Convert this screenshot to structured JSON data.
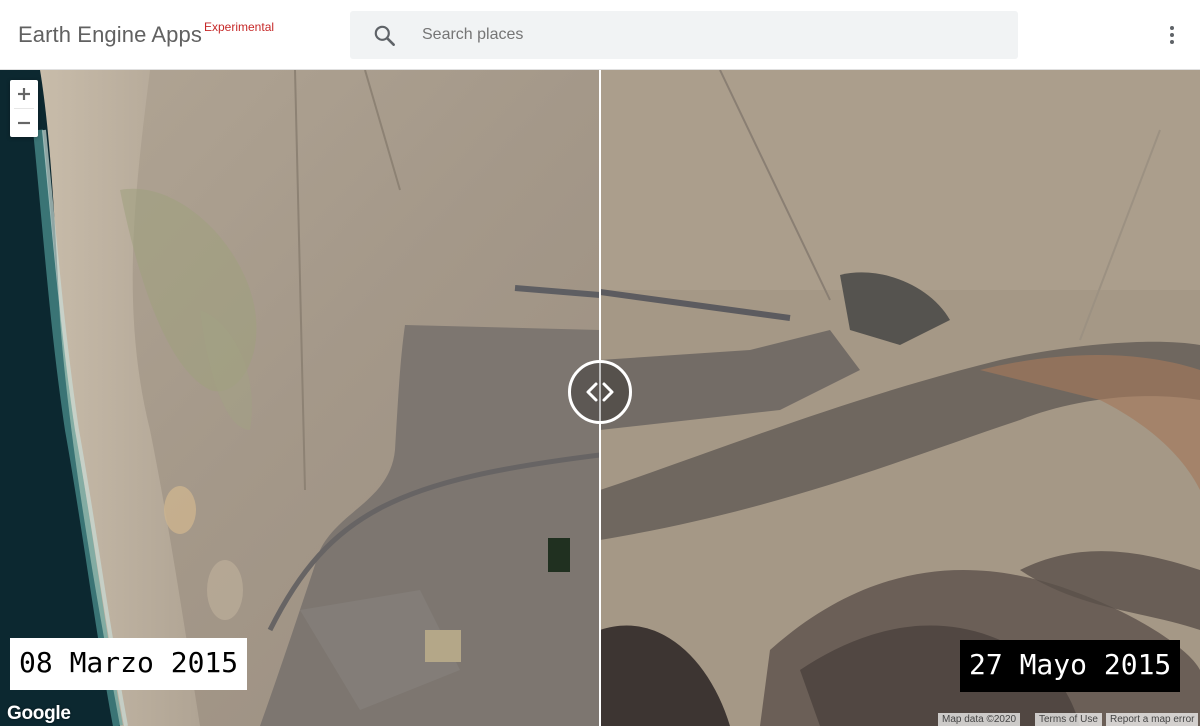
{
  "header": {
    "app_title": "Earth Engine Apps",
    "title_tag": "Experimental",
    "search": {
      "placeholder": "Search places",
      "value": "",
      "icon": "search-icon"
    },
    "menu_icon": "more-vert-icon"
  },
  "map": {
    "left_date": "08 Marzo 2015",
    "right_date": "27 Mayo 2015",
    "zoom_in_icon": "plus-icon",
    "zoom_out_icon": "minus-icon",
    "swipe_icon": "chevron-left-right-icon",
    "logo": "Google",
    "attribution": {
      "data": "Map data ©2020",
      "terms": "Terms of Use",
      "report": "Report a map error"
    }
  },
  "colors": {
    "brand_tag": "#c62828",
    "header_bg": "#ffffff",
    "search_bg": "#f1f3f4",
    "desert": "#a09384",
    "ocean": "#0c2830"
  }
}
